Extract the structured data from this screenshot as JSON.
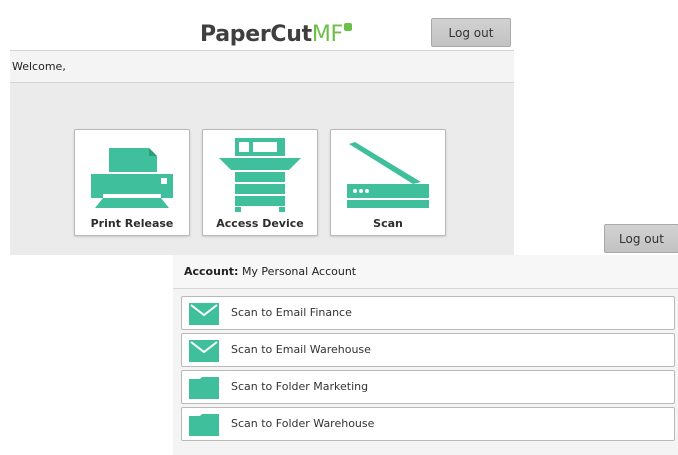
{
  "colors": {
    "accent": "#3fbf9b",
    "brand_green": "#6cc04a",
    "logo_text": "#3f3f3f"
  },
  "header": {
    "logo_text_main": "PaperCut",
    "logo_text_mf": "MF",
    "logout_label": "Log out"
  },
  "welcome": {
    "text": "Welcome,"
  },
  "tiles": [
    {
      "label": "Print Release",
      "icon": "printer-icon"
    },
    {
      "label": "Access Device",
      "icon": "copier-icon"
    },
    {
      "label": "Scan",
      "icon": "scanner-icon"
    }
  ],
  "scan_screen": {
    "logout_label": "Log out",
    "account_label": "Account:",
    "account_value": "My Personal Account",
    "items": [
      {
        "label": "Scan to Email Finance",
        "icon": "envelope-icon"
      },
      {
        "label": "Scan to Email Warehouse",
        "icon": "envelope-icon"
      },
      {
        "label": "Scan to Folder Marketing",
        "icon": "folder-icon"
      },
      {
        "label": "Scan to Folder Warehouse",
        "icon": "folder-icon"
      }
    ]
  }
}
